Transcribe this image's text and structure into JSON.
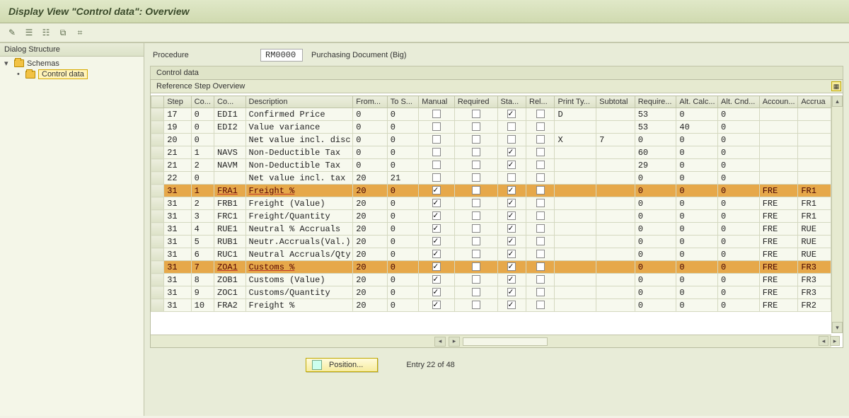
{
  "title": "Display View \"Control data\": Overview",
  "toolbar_icons": [
    "magic-wand-icon",
    "table-tree-icon",
    "table-tree2-icon",
    "table-expand-icon",
    "table-hier-icon"
  ],
  "dialog_structure": {
    "header": "Dialog Structure",
    "items": [
      {
        "label": "Schemas",
        "open": true
      },
      {
        "label": "Control data",
        "selected": true
      }
    ]
  },
  "procedure": {
    "label": "Procedure",
    "code": "RM0000",
    "desc": "Purchasing Document (Big)"
  },
  "section": "Control data",
  "subsection": "Reference Step Overview",
  "columns": [
    "Step",
    "Co...",
    "Co...",
    "Description",
    "From...",
    "To S...",
    "Manual",
    "Required",
    "Sta...",
    "Rel...",
    "Print Ty...",
    "Subtotal",
    "Require...",
    "Alt. Calc...",
    "Alt. Cnd...",
    "Accoun...",
    "Accrua"
  ],
  "rows": [
    {
      "step": "17",
      "c1": "0",
      "c2": "EDI1",
      "desc": "Confirmed Price",
      "from": "0",
      "to": "0",
      "man": false,
      "req": false,
      "sta": true,
      "rel": false,
      "print": "D",
      "sub": "",
      "reqt": "53",
      "altcalc": "0",
      "altcnd": "0",
      "acc": "",
      "accr": "",
      "hl": false
    },
    {
      "step": "19",
      "c1": "0",
      "c2": "EDI2",
      "desc": "Value variance",
      "from": "0",
      "to": "0",
      "man": false,
      "req": false,
      "sta": false,
      "rel": false,
      "print": "",
      "sub": "",
      "reqt": "53",
      "altcalc": "40",
      "altcnd": "0",
      "acc": "",
      "accr": "",
      "hl": false
    },
    {
      "step": "20",
      "c1": "0",
      "c2": "",
      "desc": "Net value incl. disc.",
      "from": "0",
      "to": "0",
      "man": false,
      "req": false,
      "sta": false,
      "rel": false,
      "print": "X",
      "sub": "7",
      "reqt": "0",
      "altcalc": "0",
      "altcnd": "0",
      "acc": "",
      "accr": "",
      "hl": false
    },
    {
      "step": "21",
      "c1": "1",
      "c2": "NAVS",
      "desc": "Non-Deductible Tax",
      "from": "0",
      "to": "0",
      "man": false,
      "req": false,
      "sta": true,
      "rel": false,
      "print": "",
      "sub": "",
      "reqt": "60",
      "altcalc": "0",
      "altcnd": "0",
      "acc": "",
      "accr": "",
      "hl": false
    },
    {
      "step": "21",
      "c1": "2",
      "c2": "NAVM",
      "desc": "Non-Deductible Tax",
      "from": "0",
      "to": "0",
      "man": false,
      "req": false,
      "sta": true,
      "rel": false,
      "print": "",
      "sub": "",
      "reqt": "29",
      "altcalc": "0",
      "altcnd": "0",
      "acc": "",
      "accr": "",
      "hl": false
    },
    {
      "step": "22",
      "c1": "0",
      "c2": "",
      "desc": "Net value incl. tax",
      "from": "20",
      "to": "21",
      "man": false,
      "req": false,
      "sta": false,
      "rel": false,
      "print": "",
      "sub": "",
      "reqt": "0",
      "altcalc": "0",
      "altcnd": "0",
      "acc": "",
      "accr": "",
      "hl": false
    },
    {
      "step": "31",
      "c1": "1",
      "c2": "FRA1",
      "desc": "Freight %",
      "from": "20",
      "to": "0",
      "man": true,
      "req": false,
      "sta": true,
      "rel": false,
      "print": "",
      "sub": "",
      "reqt": "0",
      "altcalc": "0",
      "altcnd": "0",
      "acc": "FRE",
      "accr": "FR1",
      "hl": true
    },
    {
      "step": "31",
      "c1": "2",
      "c2": "FRB1",
      "desc": "Freight (Value)",
      "from": "20",
      "to": "0",
      "man": true,
      "req": false,
      "sta": true,
      "rel": false,
      "print": "",
      "sub": "",
      "reqt": "0",
      "altcalc": "0",
      "altcnd": "0",
      "acc": "FRE",
      "accr": "FR1",
      "hl": false
    },
    {
      "step": "31",
      "c1": "3",
      "c2": "FRC1",
      "desc": "Freight/Quantity",
      "from": "20",
      "to": "0",
      "man": true,
      "req": false,
      "sta": true,
      "rel": false,
      "print": "",
      "sub": "",
      "reqt": "0",
      "altcalc": "0",
      "altcnd": "0",
      "acc": "FRE",
      "accr": "FR1",
      "hl": false
    },
    {
      "step": "31",
      "c1": "4",
      "c2": "RUE1",
      "desc": "Neutral % Accruals",
      "from": "20",
      "to": "0",
      "man": true,
      "req": false,
      "sta": true,
      "rel": false,
      "print": "",
      "sub": "",
      "reqt": "0",
      "altcalc": "0",
      "altcnd": "0",
      "acc": "FRE",
      "accr": "RUE",
      "hl": false
    },
    {
      "step": "31",
      "c1": "5",
      "c2": "RUB1",
      "desc": "Neutr.Accruals(Val.)",
      "from": "20",
      "to": "0",
      "man": true,
      "req": false,
      "sta": true,
      "rel": false,
      "print": "",
      "sub": "",
      "reqt": "0",
      "altcalc": "0",
      "altcnd": "0",
      "acc": "FRE",
      "accr": "RUE",
      "hl": false
    },
    {
      "step": "31",
      "c1": "6",
      "c2": "RUC1",
      "desc": "Neutral Accruals/Qty",
      "from": "20",
      "to": "0",
      "man": true,
      "req": false,
      "sta": true,
      "rel": false,
      "print": "",
      "sub": "",
      "reqt": "0",
      "altcalc": "0",
      "altcnd": "0",
      "acc": "FRE",
      "accr": "RUE",
      "hl": false
    },
    {
      "step": "31",
      "c1": "7",
      "c2": "ZOA1",
      "desc": "Customs %",
      "from": "20",
      "to": "0",
      "man": true,
      "req": false,
      "sta": true,
      "rel": false,
      "print": "",
      "sub": "",
      "reqt": "0",
      "altcalc": "0",
      "altcnd": "0",
      "acc": "FRE",
      "accr": "FR3",
      "hl": true
    },
    {
      "step": "31",
      "c1": "8",
      "c2": "ZOB1",
      "desc": "Customs (Value)",
      "from": "20",
      "to": "0",
      "man": true,
      "req": false,
      "sta": true,
      "rel": false,
      "print": "",
      "sub": "",
      "reqt": "0",
      "altcalc": "0",
      "altcnd": "0",
      "acc": "FRE",
      "accr": "FR3",
      "hl": false
    },
    {
      "step": "31",
      "c1": "9",
      "c2": "ZOC1",
      "desc": "Customs/Quantity",
      "from": "20",
      "to": "0",
      "man": true,
      "req": false,
      "sta": true,
      "rel": false,
      "print": "",
      "sub": "",
      "reqt": "0",
      "altcalc": "0",
      "altcnd": "0",
      "acc": "FRE",
      "accr": "FR3",
      "hl": false
    },
    {
      "step": "31",
      "c1": "10",
      "c2": "FRA2",
      "desc": "Freight %",
      "from": "20",
      "to": "0",
      "man": true,
      "req": false,
      "sta": true,
      "rel": false,
      "print": "",
      "sub": "",
      "reqt": "0",
      "altcalc": "0",
      "altcnd": "0",
      "acc": "FRE",
      "accr": "FR2",
      "hl": false
    }
  ],
  "position_button": "Position...",
  "entry_text": "Entry 22 of 48"
}
